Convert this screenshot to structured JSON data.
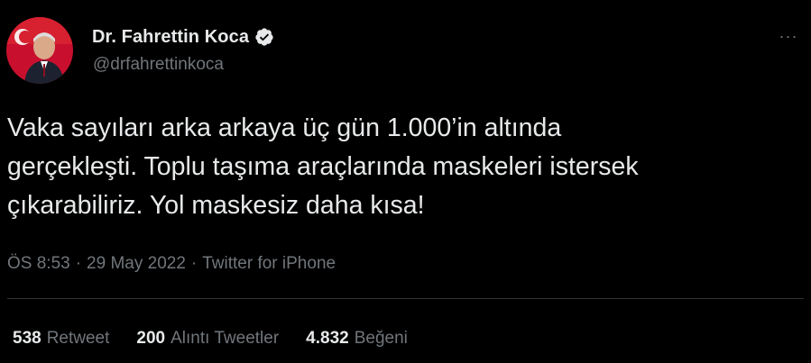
{
  "user": {
    "display_name": "Dr. Fahrettin Koca",
    "handle": "@drfahrettinkoca",
    "verified": true,
    "avatar_icon": "profile-photo"
  },
  "more_icon": "more-dots-icon",
  "more_label": "···",
  "tweet": {
    "text": "Vaka sayıları arka arkaya üç gün 1.000’in altında\ngerçekleşti. Toplu taşıma araçlarında maskeleri istersek\nçıkarabiliriz. Yol maskesiz daha kısa!"
  },
  "meta": {
    "time": "ÖS 8:53",
    "sep1": "·",
    "date": "29 May 2022",
    "sep2": "·",
    "source": "Twitter for iPhone"
  },
  "stats": {
    "retweets_count": "538",
    "retweets_label": "Retweet",
    "quotes_count": "200",
    "quotes_label": "Alıntı Tweetler",
    "likes_count": "4.832",
    "likes_label": "Beğeni"
  },
  "colors": {
    "background": "#000000",
    "text": "#e7e9ea",
    "muted": "#71767b",
    "verified_badge": "#e7e9ea",
    "divider": "#2f3336"
  }
}
